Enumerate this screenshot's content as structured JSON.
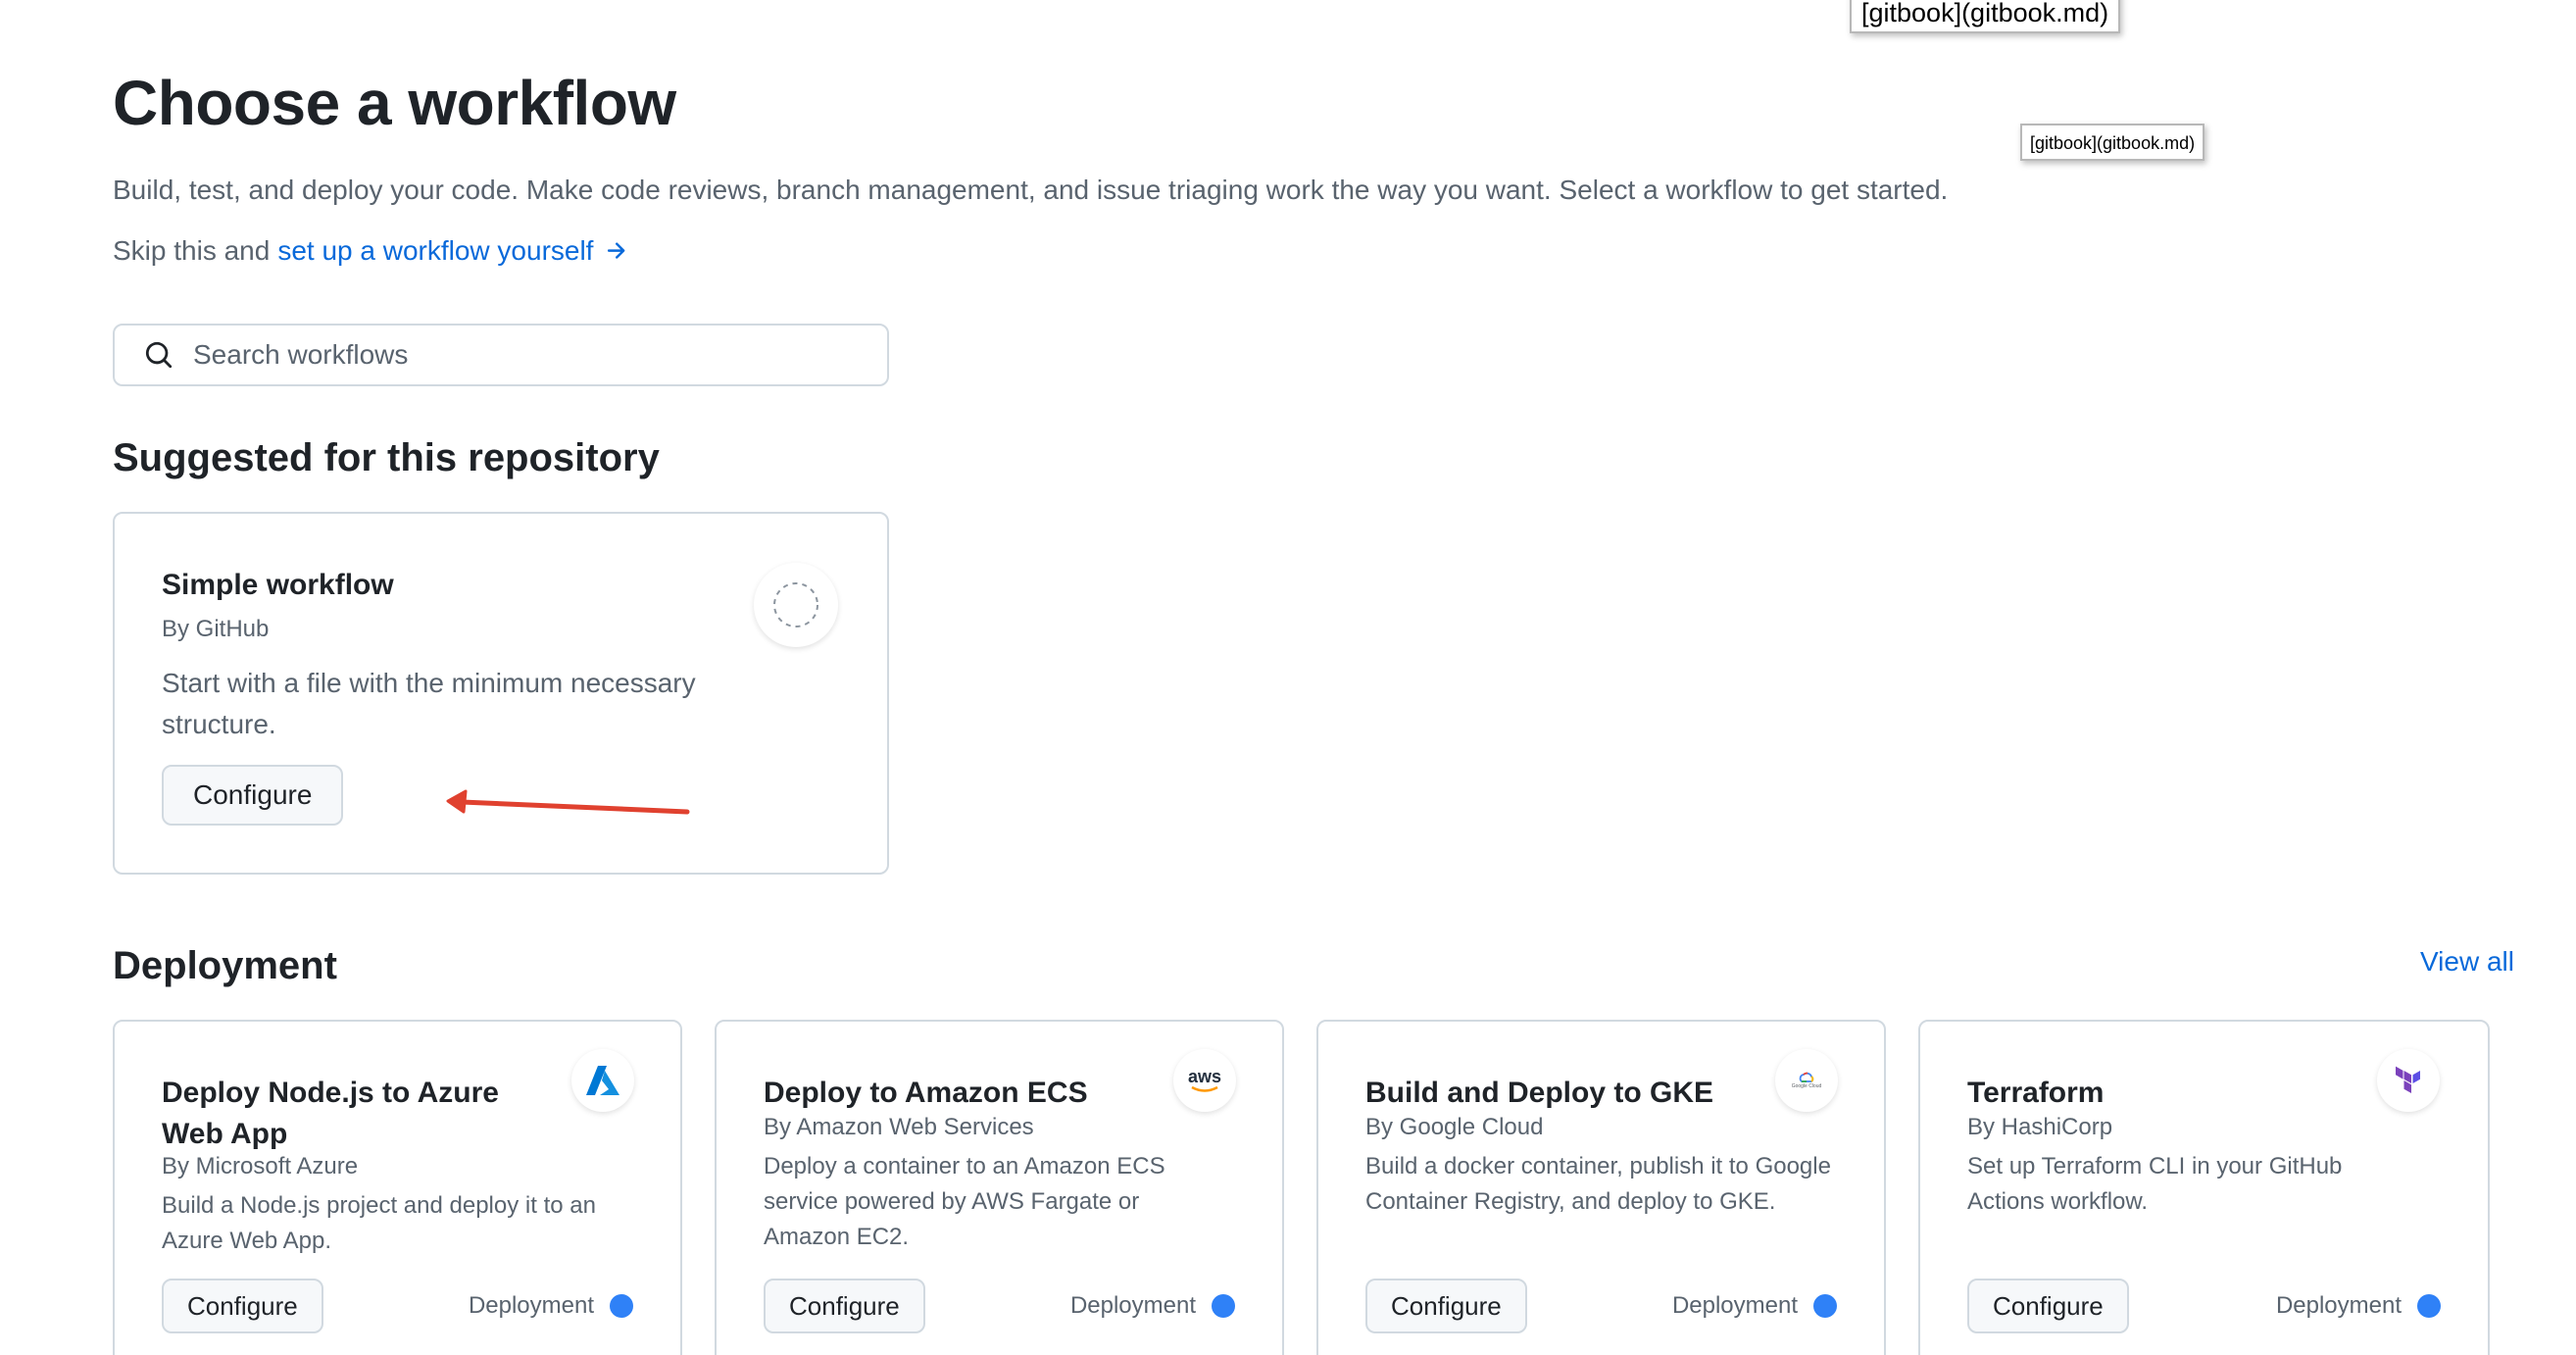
{
  "page": {
    "title": "Choose a workflow",
    "description": "Build, test, and deploy your code. Make code reviews, branch management, and issue triaging work the way you want. Select a workflow to get started.",
    "skip_prefix": "Skip this and",
    "skip_link": "set up a workflow yourself"
  },
  "search": {
    "placeholder": "Search workflows",
    "value": ""
  },
  "tooltips": {
    "top": "[gitbook](gitbook.md)",
    "small": "[gitbook](gitbook.md)"
  },
  "suggested": {
    "heading": "Suggested for this repository",
    "card": {
      "title": "Simple workflow",
      "author": "By GitHub",
      "description": "Start with a file with the minimum necessary structure.",
      "button": "Configure",
      "icon": "dashed-circle-icon"
    }
  },
  "deployment": {
    "heading": "Deployment",
    "view_all": "View all",
    "category_color": "#2f81f7",
    "cards": [
      {
        "title": "Deploy Node.js to Azure Web App",
        "author": "By Microsoft Azure",
        "description": "Build a Node.js project and deploy it to an Azure Web App.",
        "button": "Configure",
        "category": "Deployment",
        "icon": "azure-icon"
      },
      {
        "title": "Deploy to Amazon ECS",
        "author": "By Amazon Web Services",
        "description": "Deploy a container to an Amazon ECS service powered by AWS Fargate or Amazon EC2.",
        "button": "Configure",
        "category": "Deployment",
        "icon": "aws-icon",
        "icon_text": "aws"
      },
      {
        "title": "Build and Deploy to GKE",
        "author": "By Google Cloud",
        "description": "Build a docker container, publish it to Google Container Registry, and deploy to GKE.",
        "button": "Configure",
        "category": "Deployment",
        "icon": "google-cloud-icon",
        "icon_text": "Google Cloud"
      },
      {
        "title": "Terraform",
        "author": "By HashiCorp",
        "description": "Set up Terraform CLI in your GitHub Actions workflow.",
        "button": "Configure",
        "category": "Deployment",
        "icon": "terraform-icon"
      }
    ]
  },
  "colors": {
    "link": "#0969da",
    "annotation_arrow": "#e0412f",
    "border": "#d1d9e0"
  }
}
